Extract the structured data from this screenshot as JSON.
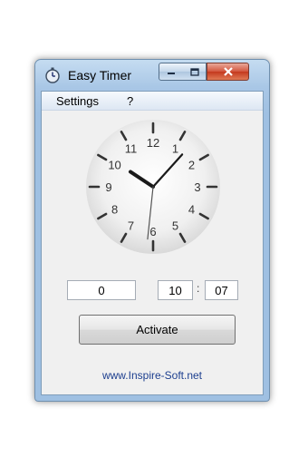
{
  "window": {
    "title": "Easy Timer",
    "icon": "stopwatch-icon"
  },
  "titlebar_buttons": {
    "minimize": "minimize-icon",
    "maximize": "maximize-icon",
    "close": "close-icon"
  },
  "menu": {
    "items": [
      "Settings",
      "?"
    ]
  },
  "clock": {
    "numbers": [
      "12",
      "1",
      "2",
      "3",
      "4",
      "5",
      "6",
      "7",
      "8",
      "9",
      "10",
      "11"
    ],
    "time_shown": {
      "hour": 10,
      "minute": 7,
      "second": 31
    }
  },
  "timer": {
    "field1": "0",
    "hours": "10",
    "separator": ":",
    "minutes": "07"
  },
  "activate_label": "Activate",
  "footer_link": "www.Inspire-Soft.net"
}
